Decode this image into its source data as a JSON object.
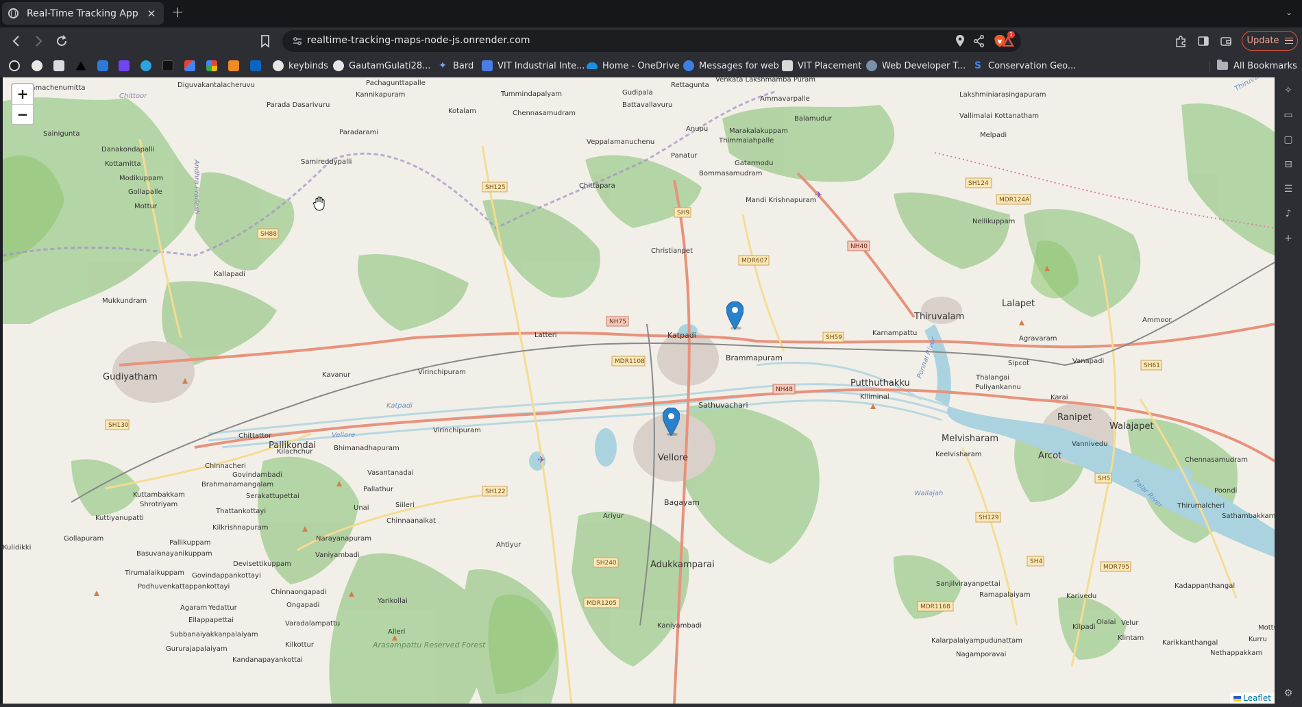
{
  "browser": {
    "tab": {
      "title": "Real-Time Tracking App",
      "close_icon": "close-icon"
    },
    "new_tab_label": "+",
    "url": "realtime-tracking-maps-node-js.onrender.com",
    "update_label": "Update",
    "rewards_badge": "1",
    "accent_color": "#e0513b"
  },
  "bookmarks": {
    "items": [
      {
        "label": "keybinds"
      },
      {
        "label": "GautamGulati28..."
      },
      {
        "label": "Bard"
      },
      {
        "label": "VIT Industrial Inte..."
      },
      {
        "label": "Home - OneDrive"
      },
      {
        "label": "Messages for web"
      },
      {
        "label": "VIT Placement"
      },
      {
        "label": "Web Developer T..."
      },
      {
        "label": "Conservation Geo..."
      }
    ],
    "all_label": "All Bookmarks"
  },
  "map": {
    "zoom_in": "+",
    "zoom_out": "−",
    "attribution": "Leaflet",
    "markers": 2,
    "towns_major": [
      "Gudiyatham",
      "Vellore",
      "Ranipet",
      "Walajapet",
      "Arcot",
      "Thiruvalam",
      "Lalapet",
      "Katpadi",
      "Pallikondai",
      "Melvisharam",
      "Putthuthakku",
      "Sathuvachari",
      "Adukkamparai",
      "Bagayam",
      "Brammapuram"
    ],
    "towns_minor": [
      "Samachenumitta",
      "Diguvakantalacheruvu",
      "Pachagunttapalle",
      "Kannikapuram",
      "Tummindapalyam",
      "Gudipala",
      "Rettagunta",
      "Venkata Lakshmamba Puram",
      "Ammavarpalle",
      "Balamudur",
      "Lakshminiarasingapuram",
      "Vallimalai Kottanatham",
      "Melpadi",
      "Parada Dasarivuru",
      "Kotalam",
      "Chennasamudram",
      "Battavallavuru",
      "Anupu",
      "Marakalakuppam",
      "Thimmaiahpalle",
      "Sainigunta",
      "Paradarami",
      "Veppalamanuchenu",
      "Panatur",
      "Samireddypalli",
      "Chittapara",
      "Bommasamudram",
      "Gatarmodu",
      "Danakondapalli",
      "Kottamitta",
      "Modikuppam",
      "Gollapalle",
      "Mottur",
      "Mandi Krishnapuram",
      "Nellikuppam",
      "Christianpet",
      "Kallapadi",
      "Mukkundram",
      "Latteri",
      "Virinchipuram",
      "Karnampattu",
      "Agravaram",
      "Ammoor",
      "Kavanur",
      "Sipcot",
      "Vanapadi",
      "Thalangai",
      "Puliyankannu",
      "Karai",
      "Klliminal",
      "Virinchipuram",
      "Bhimanadhapuram",
      "Chittattor",
      "Kilachchur",
      "Chinnacheri",
      "Govindambadi",
      "Brahmanamangalam",
      "Vasantanadai",
      "Keelvisharam",
      "Vannivedu",
      "Chennasamudram",
      "Kuttambakkam",
      "Shrotriyam",
      "Serakattupettai",
      "Pallathur",
      "Siileri",
      "Unai",
      "Chinnaanaikat",
      "Thattankottayi",
      "Kilkrishnapuram",
      "Narayanapuram",
      "Kuttiyanupatti",
      "Gollapuram",
      "Pallikuppam",
      "Ariyur",
      "Poondi",
      "Thirumalcheri",
      "Sathambakkam",
      "Vaniyambadi",
      "Basuvanayanikuppam",
      "Devisettikuppam",
      "Ahtiyur",
      "Tirumalaikuppam",
      "Govindappankottayi",
      "Podhuvenkattappankottayi",
      "Chinnaongapadi",
      "Ongapadi",
      "Yarikollai",
      "Agaram",
      "Yedattur",
      "Ellappapettai",
      "Varadalampattu",
      "Alleri",
      "Kaniyambadi",
      "Sanjilvirayanpettai",
      "Ramapalaiyam",
      "Karivedu",
      "Kadappanthangal",
      "Subbanaiyakkanpalaiyam",
      "Kilkottur",
      "Arasampattu Reserved Forest",
      "Kalarpalaiyampudunattam",
      "Kilpadi",
      "Olalai",
      "Velur",
      "Nagamporavai",
      "Klintam",
      "Karikkanthangal",
      "Nethappakkam",
      "Gururajapalaiyam",
      "Kandanapayankottai",
      "Mottu",
      "Kulidikki",
      "Kurru"
    ],
    "road_labels": [
      "SH125",
      "SH9",
      "SH88",
      "NH75",
      "NH40",
      "SH124",
      "MDR124A",
      "MDR607",
      "SH59",
      "MDR1108",
      "NH48",
      "SH61",
      "SH130",
      "SH122",
      "SH129",
      "SH5",
      "SH240",
      "SH4",
      "MDR795",
      "MDR1205",
      "MDR1168"
    ],
    "water_labels": [
      "Katpadi",
      "Vellore",
      "Ponnai River",
      "Palar River",
      "Wallajah",
      "Chittoor",
      "Andhra Pradesh",
      "Thiruvalla"
    ]
  }
}
